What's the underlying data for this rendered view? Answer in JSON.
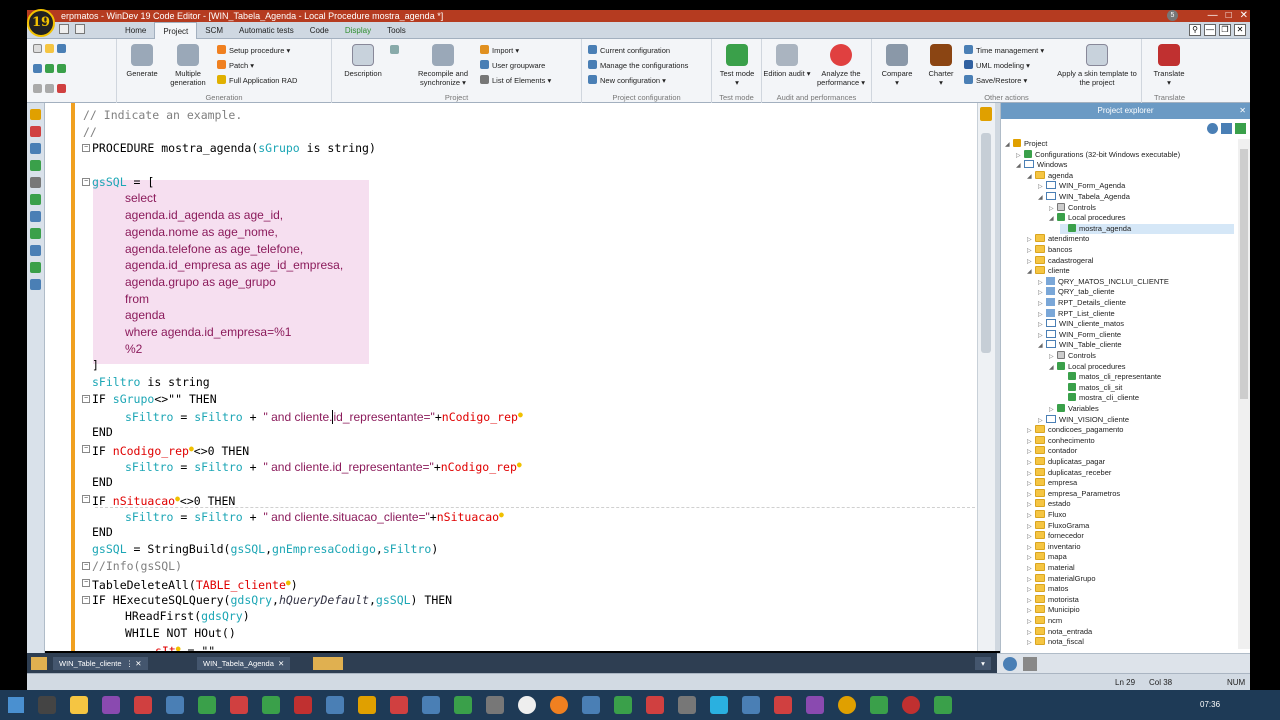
{
  "window": {
    "title": "erpmatos - WinDev 19  Code Editor - [WIN_Tabela_Agenda - Local Procedure mostra_agenda *]",
    "logo_text": "19",
    "notif_count": "5"
  },
  "ribbon_tabs": [
    "Home",
    "Project",
    "SCM",
    "Automatic tests",
    "Code",
    "Display",
    "Tools"
  ],
  "ribbon": {
    "generation": {
      "name": "Generation",
      "generate": "Generate",
      "multiple": "Multiple generation",
      "setup": "Setup procedure",
      "patch": "Patch",
      "full_rad": "Full Application RAD"
    },
    "project": {
      "name": "Project",
      "description": "Description",
      "recompile": "Recompile and synchronize",
      "import": "Import",
      "user_groupware": "User groupware",
      "list_elements": "List of Elements"
    },
    "project_config": {
      "name": "Project configuration",
      "current": "Current configuration",
      "manage": "Manage the configurations",
      "new": "New configuration"
    },
    "test_mode": {
      "name": "Test mode",
      "label": "Test mode"
    },
    "audit": {
      "name": "Audit and performances",
      "edition": "Edition audit",
      "analyze": "Analyze the performance"
    },
    "other": {
      "name": "Other actions",
      "compare": "Compare",
      "charter": "Charter",
      "time": "Time management",
      "uml": "UML modeling",
      "save_restore": "Save/Restore",
      "skin": "Apply a skin template to the project"
    },
    "translate": {
      "name": "Translate",
      "label": "Translate"
    }
  },
  "code_lines": {
    "l1": "// Indicate an example.",
    "l2": "//",
    "l3_kw": "PROCEDURE ",
    "l3_name": "mostra_agenda(",
    "l3_var": "sGrupo",
    "l3_rest": " is string)",
    "l4_var": "gsSQL",
    "l4_rest": " = [",
    "sql1": "select",
    "sql2": "agenda.id_agenda as age_id,",
    "sql3": "agenda.nome as age_nome,",
    "sql4": "agenda.telefone as age_telefone,",
    "sql5": "agenda.id_empresa as age_id_empresa,",
    "sql6": "agenda.grupo as age_grupo",
    "sql7": "from",
    "sql8": "agenda",
    "sql9": "where agenda.id_empresa=%1",
    "sql10": "%2",
    "l5": "]",
    "l6_var": "sFiltro",
    "l6_rest": " is string",
    "l7_kw": "IF ",
    "l7_var": "sGrupo",
    "l7_rest": "<>\"\" THEN",
    "l8_var1": "sFiltro",
    "l8_mid": " = ",
    "l8_var2": "sFiltro",
    "l8_plus": " + ",
    "l8_str_a": "\" and cliente.",
    "l8_str_b": "id_representante=\"",
    "l8_plus2": "+",
    "l8_err": "nCodigo_rep",
    "end": "END",
    "l9_kw": "IF ",
    "l9_err": "nCodigo_rep",
    "l9_rest": "<>0 THEN",
    "l10_str": "\" and cliente.id_representante=\"",
    "l11_err": "nSituacao",
    "l11_rest": "<>0 THEN",
    "l12_str": "\" and cliente.situacao_cliente=\"",
    "l12_err": "nSituacao",
    "l13_var1": "gsSQL",
    "l13_mid": " = StringBuild(",
    "l13_var2": "gsSQL",
    "l13_c1": ",",
    "l13_var3": "gnEmpresaCodigo",
    "l13_c2": ",",
    "l13_var4": "sFiltro",
    "l13_end": ")",
    "l14": "//Info(gsSQL)",
    "l15_fn": "TableDeleteAll(",
    "l15_err": "TABLE_cliente",
    "l15_end": ")",
    "l16_kw": "IF HExecuteSQLQuery(",
    "l16_var1": "gdsQry",
    "l16_c1": ",",
    "l16_const": "hQueryDefault",
    "l16_c2": ",",
    "l16_var2": "gsSQL",
    "l16_end": ") THEN",
    "l17_fn": "HReadFirst(",
    "l17_var": "gdsQry",
    "l17_end": ")",
    "l18": "WHILE NOT HOut()",
    "l19_err": "sIt",
    "l19_rest": " = \"\""
  },
  "explorer": {
    "title": "Project explorer",
    "nodes": [
      "Project",
      "Configurations (32-bit Windows executable)",
      "Windows",
      "agenda",
      "WIN_Form_Agenda",
      "WIN_Tabela_Agenda",
      "Controls",
      "Local procedures",
      "mostra_agenda",
      "atendimento",
      "bancos",
      "cadastrogeral",
      "cliente",
      "QRY_MATOS_INCLUI_CLIENTE",
      "QRY_tab_cliente",
      "RPT_Details_cliente",
      "RPT_List_cliente",
      "WIN_cliente_matos",
      "WIN_Form_cliente",
      "WIN_Table_cliente",
      "Controls",
      "Local procedures",
      "matos_cli_representante",
      "matos_cli_sit",
      "mostra_cli_cliente",
      "Variables",
      "WIN_VISION_cliente",
      "condicoes_pagamento",
      "conhecimento",
      "contador",
      "duplicatas_pagar",
      "duplicatas_receber",
      "empresa",
      "empresa_Parametros",
      "estado",
      "Fluxo",
      "FluxoGrama",
      "fornecedor",
      "inventario",
      "mapa",
      "material",
      "materialGrupo",
      "matos",
      "motorista",
      "Municipio",
      "ncm",
      "nota_entrada",
      "nota_fiscal"
    ]
  },
  "doc_tabs": [
    "WIN_Table_cliente",
    "WIN_Tabela_Agenda"
  ],
  "status": {
    "line": "Ln 29",
    "col": "Col 38",
    "num": "NUM"
  },
  "clock": "07:36"
}
